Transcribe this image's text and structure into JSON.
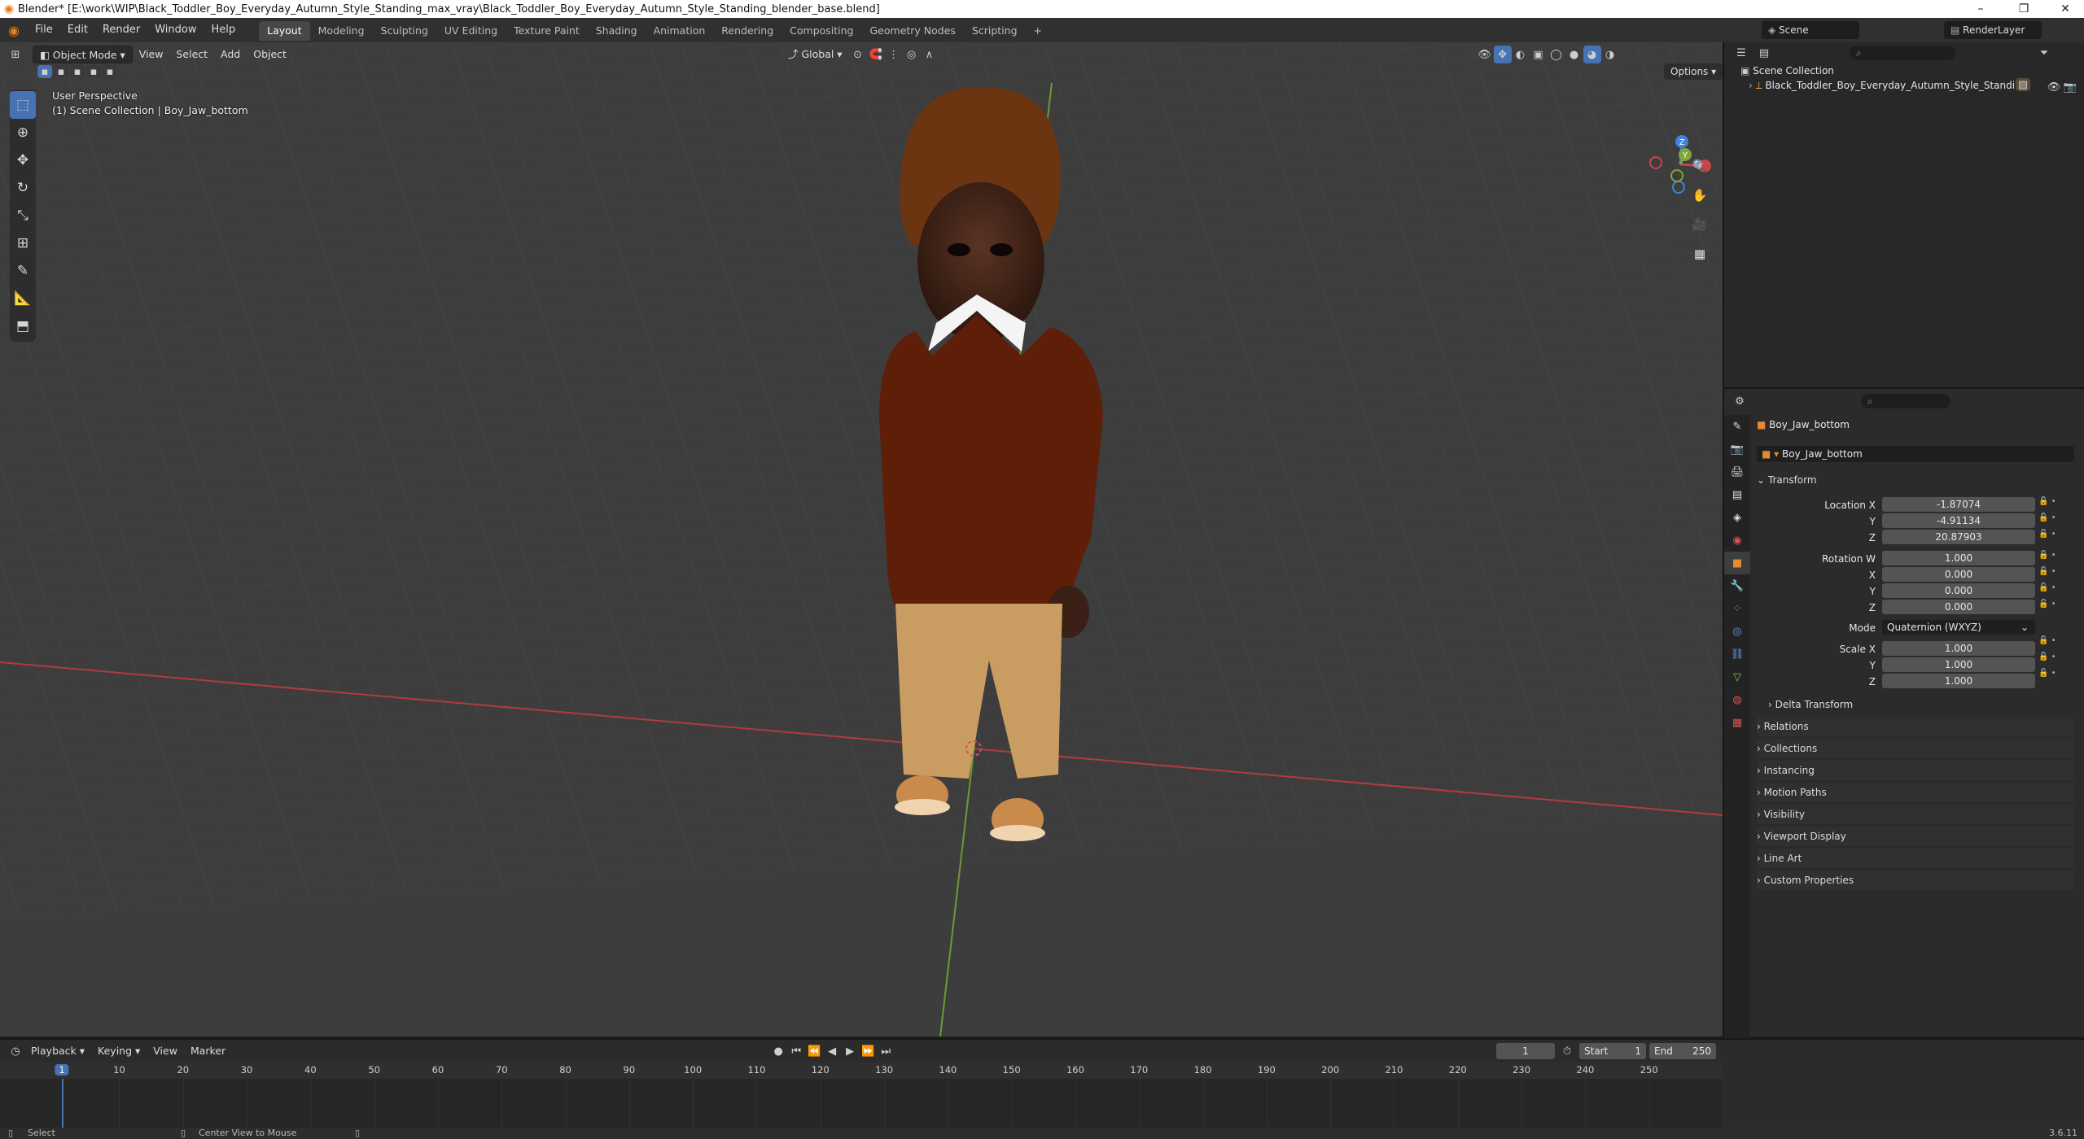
{
  "window": {
    "title": "Blender* [E:\\work\\WIP\\Black_Toddler_Boy_Everyday_Autumn_Style_Standing_max_vray\\Black_Toddler_Boy_Everyday_Autumn_Style_Standing_blender_base.blend]",
    "min": "–",
    "max": "❐",
    "close": "✕"
  },
  "menus": [
    "File",
    "Edit",
    "Render",
    "Window",
    "Help"
  ],
  "workspaces": [
    "Layout",
    "Modeling",
    "Sculpting",
    "UV Editing",
    "Texture Paint",
    "Shading",
    "Animation",
    "Rendering",
    "Compositing",
    "Geometry Nodes",
    "Scripting"
  ],
  "workspace_add": "+",
  "scene": {
    "name": "Scene",
    "view_layer": "RenderLayer"
  },
  "viewport": {
    "mode": "Object Mode",
    "menus": [
      "View",
      "Select",
      "Add",
      "Object"
    ],
    "orientation": "Global",
    "info_line1": "User Perspective",
    "info_line2": "(1) Scene Collection | Boy_Jaw_bottom",
    "options": "Options",
    "gizmo": {
      "x": "X",
      "y": "Y",
      "z": "Z"
    }
  },
  "outliner": {
    "root": "Scene Collection",
    "item": "Black_Toddler_Boy_Everyday_Autumn_Style_Standing"
  },
  "properties": {
    "object_name": "Boy_Jaw_bottom",
    "data_name": "Boy_Jaw_bottom",
    "transform_title": "Transform",
    "location_label": "Location X",
    "location": [
      "-1.87074",
      "-4.91134",
      "20.87903"
    ],
    "rotation_label": "Rotation W",
    "rotation": [
      "1.000",
      "0.000",
      "0.000",
      "0.000"
    ],
    "axis_x": "X",
    "axis_y": "Y",
    "axis_z": "Z",
    "mode_label": "Mode",
    "mode_value": "Quaternion (WXYZ)",
    "scale_label": "Scale X",
    "scale": [
      "1.000",
      "1.000",
      "1.000"
    ],
    "delta": "Delta Transform",
    "panels": [
      "Relations",
      "Collections",
      "Instancing",
      "Motion Paths",
      "Visibility",
      "Viewport Display",
      "Line Art",
      "Custom Properties"
    ]
  },
  "timeline": {
    "menus": [
      "Playback",
      "Keying",
      "View",
      "Marker"
    ],
    "current_frame": "1",
    "start_label": "Start",
    "start": "1",
    "end_label": "End",
    "end": "250",
    "ticks": [
      "1",
      "10",
      "20",
      "30",
      "40",
      "50",
      "60",
      "70",
      "80",
      "90",
      "100",
      "110",
      "120",
      "130",
      "140",
      "150",
      "160",
      "170",
      "180",
      "190",
      "200",
      "210",
      "220",
      "230",
      "240",
      "250"
    ]
  },
  "status": {
    "left": "Select",
    "middle": "Center View to Mouse",
    "version": "3.6.11"
  },
  "colors": {
    "accent": "#4772b3",
    "active_frame": "#4772b3",
    "x_axis": "#c8444a",
    "y_axis": "#7fa63a",
    "z_axis": "#3f82d9"
  }
}
